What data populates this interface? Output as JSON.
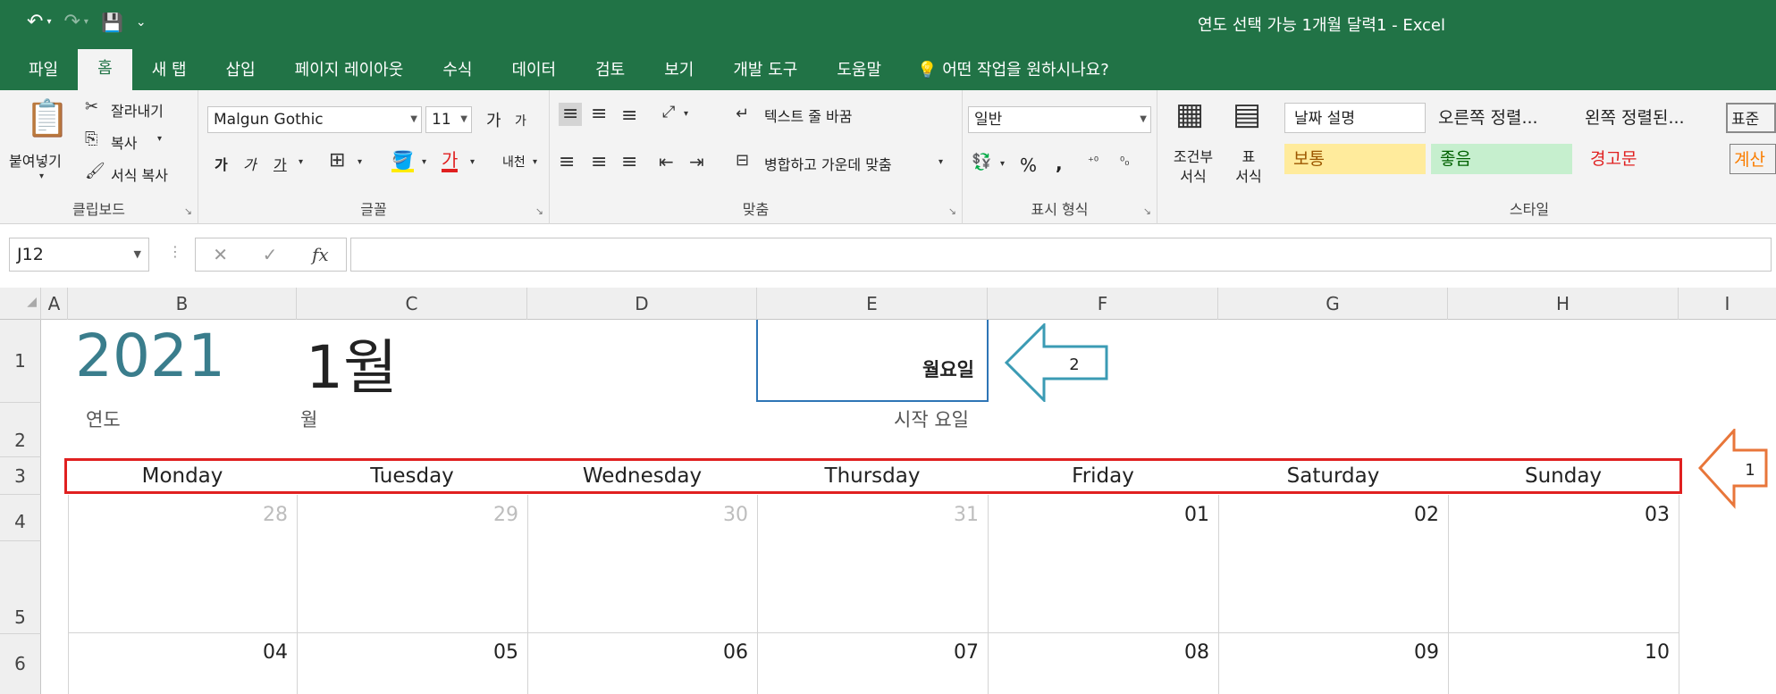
{
  "window": {
    "title": "연도 선택 가능 1개월 달력1  -  Excel"
  },
  "qat": {
    "undo": "↶",
    "redo": "↷",
    "save": "💾",
    "customize": "⌄"
  },
  "tabs": [
    "파일",
    "홈",
    "새 탭",
    "삽입",
    "페이지 레이아웃",
    "수식",
    "데이터",
    "검토",
    "보기",
    "개발 도구",
    "도움말"
  ],
  "tell_me": "어떤 작업을 원하시나요?",
  "ribbon": {
    "clipboard": {
      "paste": "붙여넣기",
      "cut": "잘라내기",
      "copy": "복사",
      "format_painter": "서식 복사",
      "label": "클립보드"
    },
    "font": {
      "name": "Malgun Gothic",
      "size": "11",
      "grow": "가",
      "shrink": "가",
      "bold": "가",
      "italic": "가",
      "underline": "가",
      "label": "글꼴",
      "phonetic": "내천"
    },
    "alignment": {
      "wrap": "텍스트 줄 바꿈",
      "merge": "병합하고 가운데 맞춤",
      "label": "맞춤"
    },
    "number": {
      "format": "일반",
      "percent": "%",
      "comma": ",",
      "label": "표시 형식"
    },
    "cond": {
      "cond_format": "조건부\n서식",
      "table": "표\n서식"
    },
    "styles": {
      "date_desc": "날짜 설명",
      "right_align": "오른쪽 정렬...",
      "left_align": "왼쪽 정렬된...",
      "standard": "표준",
      "normal": "보통",
      "good": "좋음",
      "warning": "경고문",
      "calc": "계산",
      "label": "스타일"
    }
  },
  "formula_bar": {
    "name_box": "J12",
    "fx": "fx",
    "value": ""
  },
  "columns": [
    "A",
    "B",
    "C",
    "D",
    "E",
    "F",
    "G",
    "H",
    "I"
  ],
  "rows": [
    "1",
    "2",
    "3",
    "4",
    "5",
    "6"
  ],
  "sheet": {
    "year": "2021",
    "month": "1월",
    "start_day": "월요일",
    "year_label": "연도",
    "month_label": "월",
    "start_label": "시작 요일",
    "weekdays": [
      "Monday",
      "Tuesday",
      "Wednesday",
      "Thursday",
      "Friday",
      "Saturday",
      "Sunday"
    ],
    "week1": [
      "28",
      "29",
      "30",
      "31",
      "01",
      "02",
      "03"
    ],
    "week2": [
      "04",
      "05",
      "06",
      "07",
      "08",
      "09",
      "10"
    ]
  },
  "callouts": {
    "one": "1",
    "two": "2"
  },
  "colors": {
    "excel_green": "#217346",
    "year_teal": "#3a7d8c",
    "red_box": "#e02020",
    "blue_box": "#2e75b6",
    "arrow_orange": "#e8763a",
    "arrow_teal": "#3b9bb4",
    "prev_month_gray": "#bdbdbd"
  }
}
